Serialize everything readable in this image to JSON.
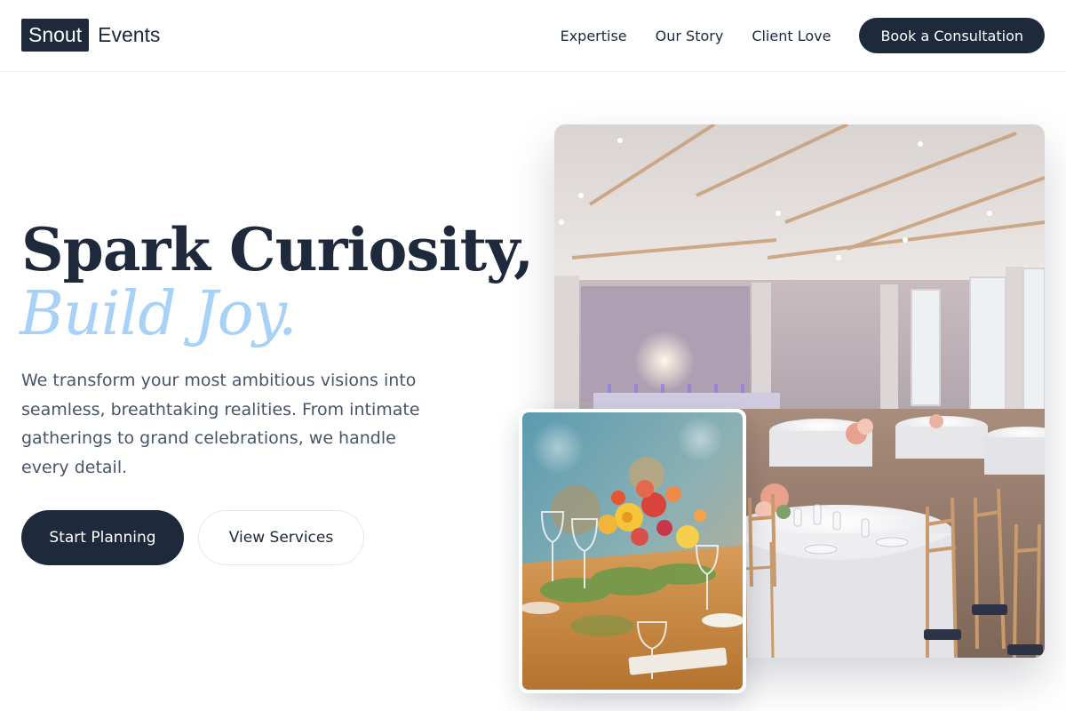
{
  "header": {
    "brand_mark": "Snout",
    "brand_word": "Events",
    "nav": [
      {
        "label": "Expertise"
      },
      {
        "label": "Our Story"
      },
      {
        "label": "Client Love"
      }
    ],
    "cta_label": "Book a Consultation"
  },
  "hero": {
    "headline": "Spark Curiosity,",
    "headline_accent": "Build Joy.",
    "description": "We transform your most ambitious visions into seamless, breathtaking realities. From intimate gatherings to grand celebrations, we handle every detail.",
    "primary_button": "Start Planning",
    "secondary_button": "View Services"
  },
  "colors": {
    "navy": "#1e293b",
    "accent_blue": "#a7d1f5",
    "body_text": "#475569"
  }
}
